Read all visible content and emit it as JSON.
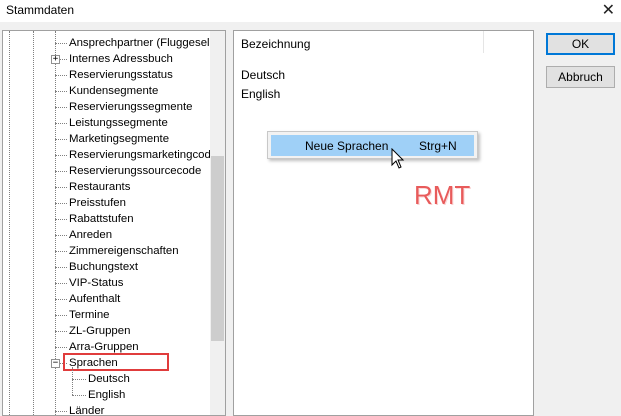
{
  "window": {
    "title": "Stammdaten",
    "close_glyph": "✕"
  },
  "tree": {
    "items": [
      {
        "label": "Ansprechpartner (Fluggesellsc"
      },
      {
        "label": "Internes Adressbuch",
        "expander": "+"
      },
      {
        "label": "Reservierungsstatus"
      },
      {
        "label": "Kundensegmente"
      },
      {
        "label": "Reservierungssegmente"
      },
      {
        "label": "Leistungssegmente"
      },
      {
        "label": "Marketingsegmente"
      },
      {
        "label": "Reservierungsmarketingcode"
      },
      {
        "label": "Reservierungssourcecode"
      },
      {
        "label": "Restaurants"
      },
      {
        "label": "Preisstufen"
      },
      {
        "label": "Rabattstufen"
      },
      {
        "label": "Anreden"
      },
      {
        "label": "Zimmereigenschaften"
      },
      {
        "label": "Buchungstext"
      },
      {
        "label": "VIP-Status"
      },
      {
        "label": "Aufenthalt"
      },
      {
        "label": "Termine"
      },
      {
        "label": "ZL-Gruppen"
      },
      {
        "label": "Arra-Gruppen"
      },
      {
        "label": "Sprachen",
        "expander": "−",
        "selected": true
      },
      {
        "label": "Deutsch",
        "child": true
      },
      {
        "label": "English",
        "child": true
      },
      {
        "label": "Länder"
      }
    ]
  },
  "list": {
    "column_header": "Bezeichnung",
    "rows": [
      "Deutsch",
      "English"
    ]
  },
  "context_menu": {
    "item_label": "Neue Sprachen",
    "item_shortcut": "Strg+N"
  },
  "watermark": "RMT",
  "buttons": {
    "ok": "OK",
    "cancel": "Abbruch"
  },
  "colors": {
    "menu_highlight": "#9fd0f7",
    "selection_box": "#e03c3c",
    "default_button_border": "#0078d7"
  }
}
